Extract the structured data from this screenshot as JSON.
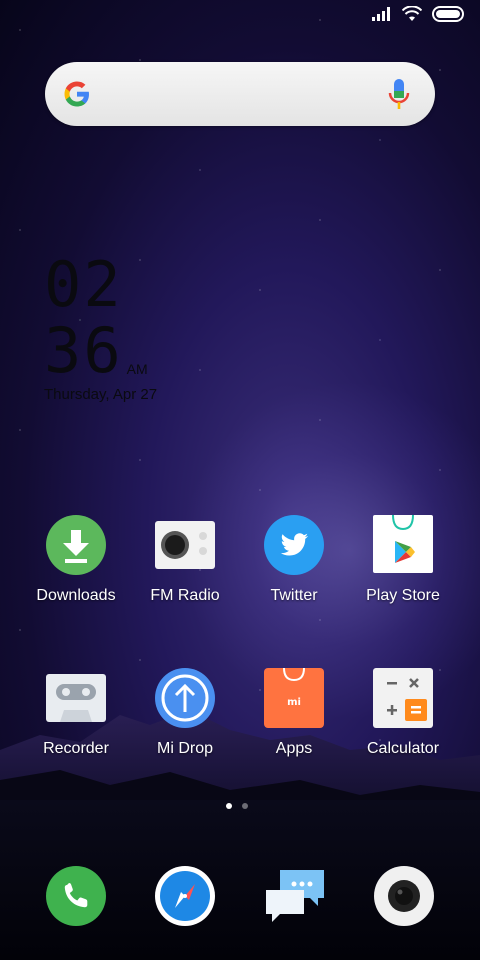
{
  "status_bar": {
    "icons": [
      "signal-icon",
      "wifi-icon",
      "battery-icon"
    ]
  },
  "search": {
    "logo": "google-g-icon",
    "voice": "microphone-icon"
  },
  "clock": {
    "hour": "02",
    "minute": "36",
    "ampm": "AM",
    "date": "Thursday, Apr 27"
  },
  "apps": [
    {
      "label": "Downloads",
      "icon": "download-arrow-icon",
      "color": "#5cb85c"
    },
    {
      "label": "FM Radio",
      "icon": "radio-icon",
      "color": "#f2f2f2"
    },
    {
      "label": "Twitter",
      "icon": "twitter-bird-icon",
      "color": "#2a9ff2"
    },
    {
      "label": "Play Store",
      "icon": "play-store-icon",
      "color": "#ffffff"
    },
    {
      "label": "Recorder",
      "icon": "cassette-icon",
      "color": "#e8ecf0"
    },
    {
      "label": "Mi Drop",
      "icon": "upload-arrow-icon",
      "color": "#4a90f0"
    },
    {
      "label": "Apps",
      "icon": "mi-shopping-bag-icon",
      "color": "#ff7340"
    },
    {
      "label": "Calculator",
      "icon": "calculator-icon",
      "color": "#f2f2f2"
    }
  ],
  "pager": {
    "pages": 2,
    "active": 1
  },
  "dock": [
    {
      "name": "phone",
      "icon": "phone-icon",
      "color": "#3fb24e"
    },
    {
      "name": "browser",
      "icon": "compass-icon",
      "color": "#1e88e5"
    },
    {
      "name": "messaging",
      "icon": "chat-bubbles-icon",
      "color": "#7cc3f5"
    },
    {
      "name": "camera",
      "icon": "camera-icon",
      "color": "#f0f0f0"
    }
  ]
}
